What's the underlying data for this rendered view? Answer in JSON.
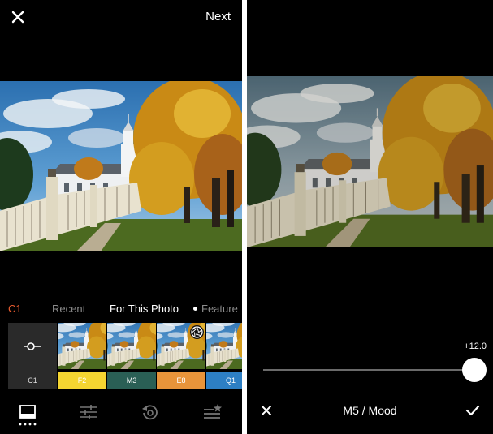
{
  "left_screen": {
    "top_bar": {
      "next_label": "Next",
      "close_icon": "close-icon"
    },
    "filter_tabs": [
      {
        "label": "C1",
        "state": "current-preset"
      },
      {
        "label": "Recent",
        "state": "inactive"
      },
      {
        "label": "For This Photo",
        "state": "active"
      },
      {
        "label": "Feature",
        "state": "inactive"
      }
    ],
    "filter_strip": [
      {
        "label": "C1",
        "color": "#2a2a2a",
        "kind": "current"
      },
      {
        "label": "F2",
        "color": "#f5d631",
        "kind": "preset"
      },
      {
        "label": "M3",
        "color": "#2a5f55",
        "kind": "preset"
      },
      {
        "label": "E8",
        "color": "#e8943a",
        "kind": "preset",
        "badge": "aperture-icon"
      },
      {
        "label": "Q1",
        "color": "#2d7fc4",
        "kind": "preset"
      }
    ],
    "toolbar": [
      {
        "name": "filters-tab",
        "icon": "filter-frame-icon",
        "active": true
      },
      {
        "name": "adjust-tab",
        "icon": "sliders-icon",
        "active": false
      },
      {
        "name": "history-tab",
        "icon": "history-icon",
        "active": false
      },
      {
        "name": "recipes-tab",
        "icon": "recipes-icon",
        "active": false
      }
    ]
  },
  "right_screen": {
    "strength_value": "+12.0",
    "strength_level": 1.0,
    "preset_title": "M5 / Mood",
    "cancel_icon": "close-icon",
    "confirm_icon": "checkmark-icon"
  },
  "colors": {
    "accent": "#e65a2e",
    "background": "#000000",
    "divider": "#ffffff"
  }
}
